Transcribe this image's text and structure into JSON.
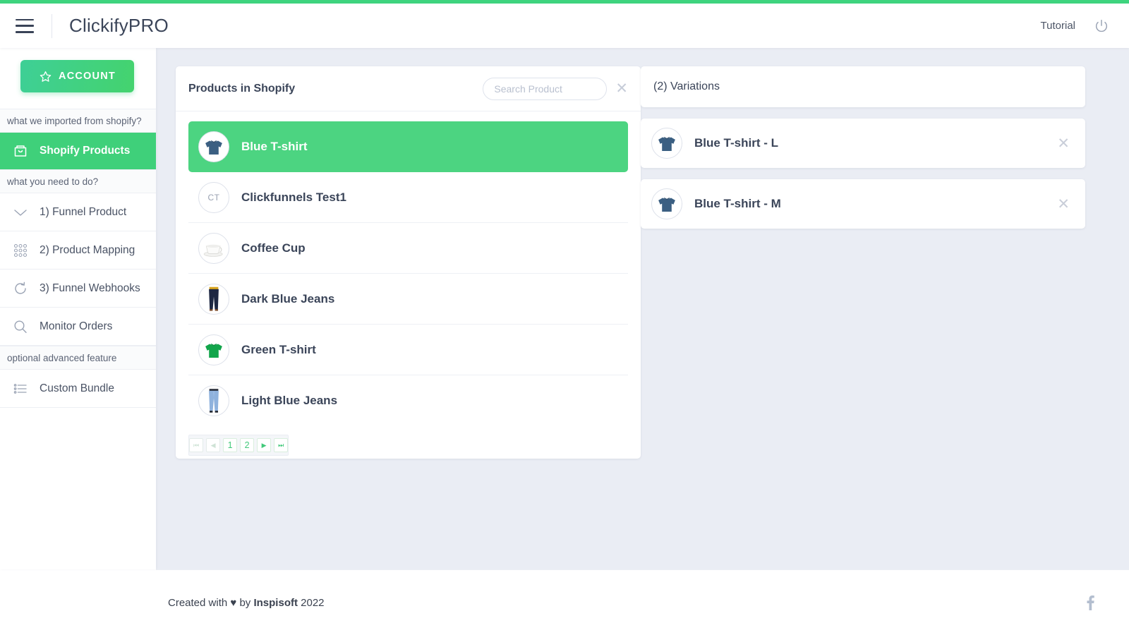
{
  "theme": {
    "accent_green": "#3ed47e",
    "selected_green": "#4cd481",
    "sidebar_active_green": "#3fd07a",
    "page_bg": "#eaedf4",
    "text_dark": "#3b4559"
  },
  "header": {
    "menu_icon": "hamburger-icon",
    "brand": "ClickifyPRO",
    "tutorial_label": "Tutorial",
    "power_icon": "power-icon"
  },
  "sidebar": {
    "account_button": {
      "label": "ACCOUNT",
      "icon": "star-icon"
    },
    "groups": [
      {
        "section_label": "what we imported from shopify?",
        "items": [
          {
            "label": "Shopify Products",
            "icon": "shopping-bag-icon",
            "active": true
          }
        ]
      },
      {
        "section_label": "what you need to do?",
        "items": [
          {
            "label": "1) Funnel Product",
            "icon": "chevron-down-icon",
            "active": false
          },
          {
            "label": "2) Product Mapping",
            "icon": "grid-dots-icon",
            "active": false
          },
          {
            "label": "3) Funnel Webhooks",
            "icon": "refresh-icon",
            "active": false
          },
          {
            "label": "Monitor Orders",
            "icon": "search-icon",
            "active": false
          }
        ]
      },
      {
        "section_label": "optional advanced feature",
        "items": [
          {
            "label": "Custom Bundle",
            "icon": "list-icon",
            "active": false
          }
        ]
      }
    ]
  },
  "products_panel": {
    "title": "Products in Shopify",
    "search": {
      "value": "",
      "placeholder": "Search Product"
    },
    "clear_icon": "close-icon",
    "items": [
      {
        "name": "Blue T-shirt",
        "thumb": "blue-tshirt-thumb",
        "selected": true
      },
      {
        "name": "Clickfunnels Test1",
        "thumb": "initials-ct-thumb",
        "initials": "CT",
        "selected": false
      },
      {
        "name": "Coffee Cup",
        "thumb": "coffee-cup-thumb",
        "selected": false
      },
      {
        "name": "Dark Blue Jeans",
        "thumb": "dark-blue-jeans-thumb",
        "selected": false
      },
      {
        "name": "Green T-shirt",
        "thumb": "green-tshirt-thumb",
        "selected": false
      },
      {
        "name": "Light Blue Jeans",
        "thumb": "light-blue-jeans-thumb",
        "selected": false
      }
    ],
    "pagination": {
      "first_label": "⏮",
      "prev_label": "◀",
      "pages": [
        "1",
        "2"
      ],
      "current_page": "1",
      "next_label": "▶",
      "last_label": "⏭"
    }
  },
  "variations_panel": {
    "title": "(2) Variations",
    "items": [
      {
        "name": "Blue T-shirt - L",
        "thumb": "blue-tshirt-thumb",
        "remove_icon": "close-icon"
      },
      {
        "name": "Blue T-shirt - M",
        "thumb": "blue-tshirt-thumb",
        "remove_icon": "close-icon"
      }
    ]
  },
  "footer": {
    "prefix": "Created with ",
    "heart": "♥",
    "middle": " by ",
    "company": "Inspisoft",
    "year": " 2022",
    "social_icon": "facebook-icon"
  }
}
